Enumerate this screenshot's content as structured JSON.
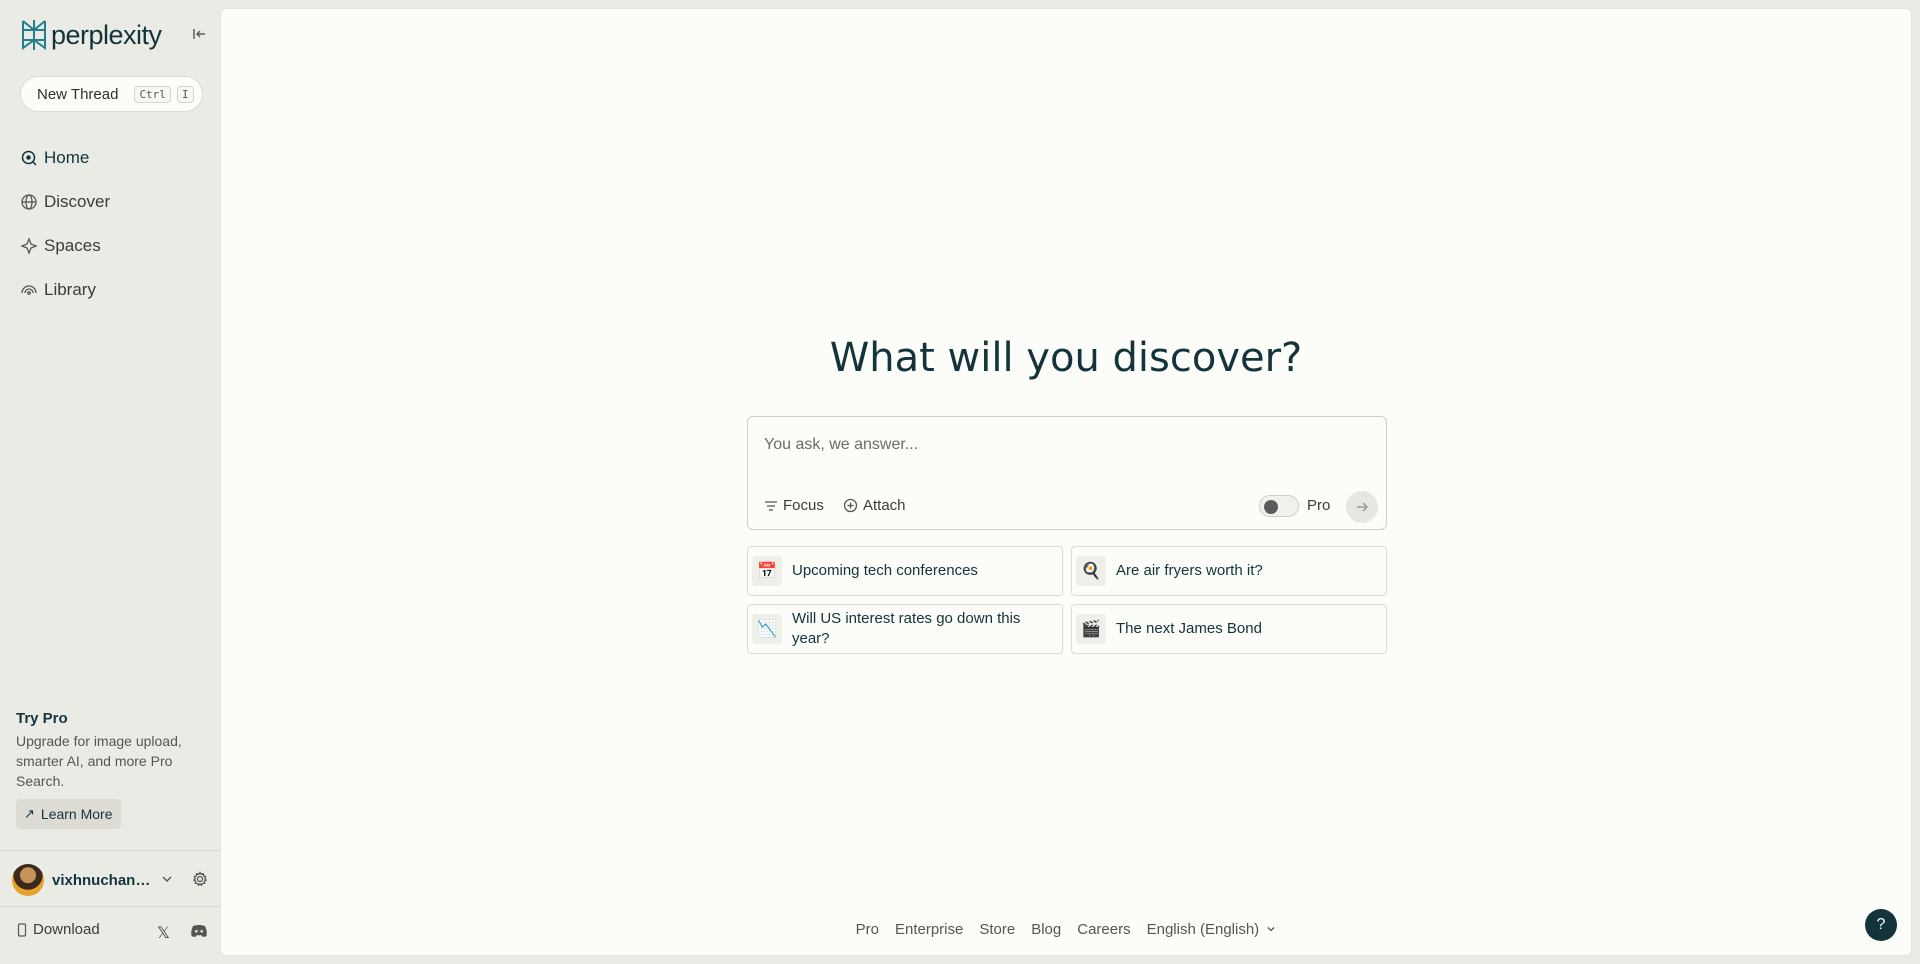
{
  "app": {
    "name": "perplexity"
  },
  "sidebar": {
    "new_thread": {
      "label": "New Thread",
      "shortcut_1": "Ctrl",
      "shortcut_2": "I"
    },
    "nav": [
      {
        "label": "Home",
        "icon": "home-search-icon",
        "active": true
      },
      {
        "label": "Discover",
        "icon": "globe-icon"
      },
      {
        "label": "Spaces",
        "icon": "spaces-icon"
      },
      {
        "label": "Library",
        "icon": "library-icon"
      }
    ],
    "promo": {
      "title": "Try Pro",
      "description": "Upgrade for image upload, smarter AI, and more Pro Search.",
      "button": "Learn More"
    },
    "user": {
      "name": "vixhnuchan5..."
    },
    "download": "Download"
  },
  "main": {
    "title": "What will you discover?",
    "ask": {
      "placeholder": "You ask, we answer...",
      "focus": "Focus",
      "attach": "Attach",
      "pro": "Pro"
    },
    "suggestions": [
      {
        "emoji": "📅",
        "label": "Upcoming tech conferences"
      },
      {
        "emoji": "🍳",
        "label": "Are air fryers worth it?"
      },
      {
        "emoji": "📉",
        "label": "Will US interest rates go down this year?"
      },
      {
        "emoji": "🎬",
        "label": "The next James Bond"
      }
    ],
    "footer": [
      "Pro",
      "Enterprise",
      "Store",
      "Blog",
      "Careers",
      "English (English)"
    ],
    "help": "?"
  },
  "colors": {
    "brand": "#13343b",
    "accent": "#20808d",
    "sidebar_bg": "#ebebe6",
    "main_bg": "#fcfcf9"
  }
}
